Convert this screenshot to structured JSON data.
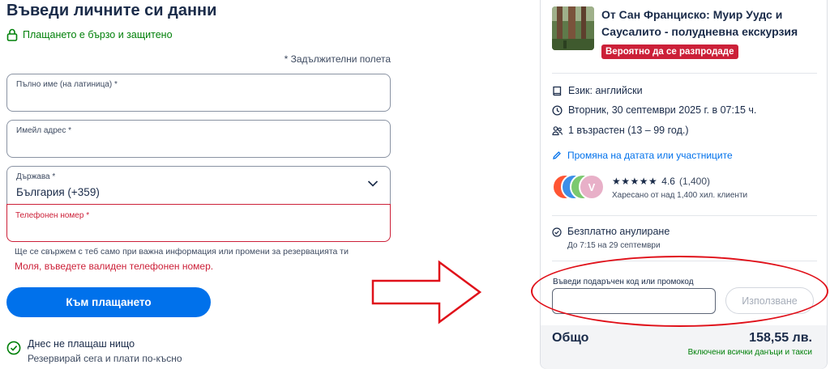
{
  "form": {
    "title": "Въведи личните си данни",
    "secure_note": "Плащането е бързо и защитено",
    "required_note": "* Задължителни полета",
    "full_name": {
      "label": "Пълно име (на латиница) *",
      "value": ""
    },
    "email": {
      "label": "Имейл адрес *",
      "value": ""
    },
    "country": {
      "label": "Държава *",
      "value": "България (+359)"
    },
    "phone": {
      "label": "Телефонен номер *",
      "value": ""
    },
    "help_text": "Ще се свържем с теб само при важна информация или промени за резервацията ти",
    "error_text": "Моля, въведете валиден телефонен номер.",
    "submit_label": "Към плащането",
    "no_pay_title": "Днес не плащаш нищо",
    "no_pay_subtitle": "Резервирай сега и плати по-късно"
  },
  "summary": {
    "product_title": "От Сан Франциско: Муир Уудс и Саусалито - полудневна екскурзия",
    "badge": "Вероятно да се разпродаде",
    "language": "Език: английски",
    "datetime": "Вторник, 30 септември 2025 г. в 07:15 ч.",
    "participants": "1 възрастен (13 – 99 год.)",
    "change_link": "Промяна на датата или участниците",
    "avatar_letter": "V",
    "stars": "★★★★★",
    "rating": "4.6",
    "rating_count": "(1,400)",
    "liked_by": "Харесано от над 1,400 хил. клиенти",
    "cancel_title": "Безплатно анулиране",
    "cancel_deadline": "До 7:15 на 29 септември",
    "promo_label": "Въведи подаръчен код или промокод",
    "promo_value": "",
    "apply_label": "Използване",
    "total_label": "Общо",
    "total_price": "158,55 лв.",
    "taxes_note": "Включени всички данъци и такси"
  },
  "colors": {
    "primary": "#0071eb",
    "error": "#cc2038",
    "success": "#008009",
    "text": "#1a2b49",
    "annotation": "#e0111a"
  },
  "icons": {
    "secure": "lock-icon",
    "country_select": "chevron-down-icon",
    "no_pay": "check-circle-icon",
    "language": "book-icon",
    "datetime": "clock-icon",
    "participants": "people-icon",
    "change": "pencil-icon",
    "cancel": "check-circle-icon",
    "annotation_arrow": "arrow-right-icon"
  }
}
